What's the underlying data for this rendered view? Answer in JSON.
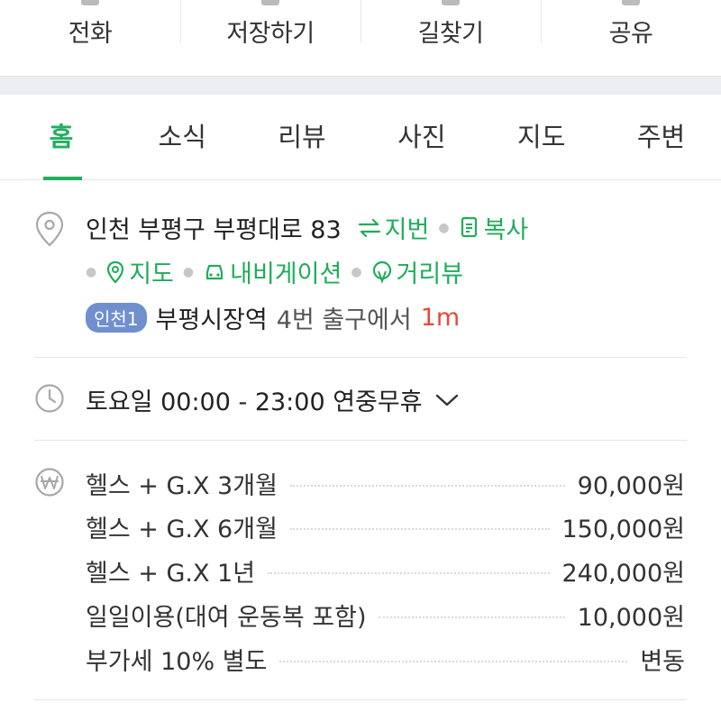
{
  "actions": [
    {
      "label": "전화"
    },
    {
      "label": "저장하기"
    },
    {
      "label": "길찾기"
    },
    {
      "label": "공유"
    }
  ],
  "tabs": [
    {
      "label": "홈",
      "active": true
    },
    {
      "label": "소식"
    },
    {
      "label": "리뷰"
    },
    {
      "label": "사진"
    },
    {
      "label": "지도"
    },
    {
      "label": "주변"
    }
  ],
  "address": {
    "text": "인천 부평구 부평대로 83",
    "jibun_label": "지번",
    "copy_label": "복사",
    "map_label": "지도",
    "navigation_label": "내비게이션",
    "streetview_label": "거리뷰",
    "subway_line": "인천1",
    "station": "부평시장역",
    "exit_text": "4번 출구에서",
    "distance": "1m"
  },
  "hours": {
    "text": "토요일 00:00 - 23:00 연중무휴"
  },
  "prices": [
    {
      "name": "헬스 + G.X 3개월",
      "value": "90,000원"
    },
    {
      "name": "헬스 + G.X 6개월",
      "value": "150,000원"
    },
    {
      "name": "헬스 + G.X 1년",
      "value": "240,000원"
    },
    {
      "name": "일일이용(대여 운동복 포함)",
      "value": "10,000원"
    },
    {
      "name": "부가세 10% 별도",
      "value": "변동"
    }
  ],
  "colors": {
    "accent": "#21ac5b",
    "subway_badge": "#6f8fcf",
    "distance": "#e24b3b"
  }
}
